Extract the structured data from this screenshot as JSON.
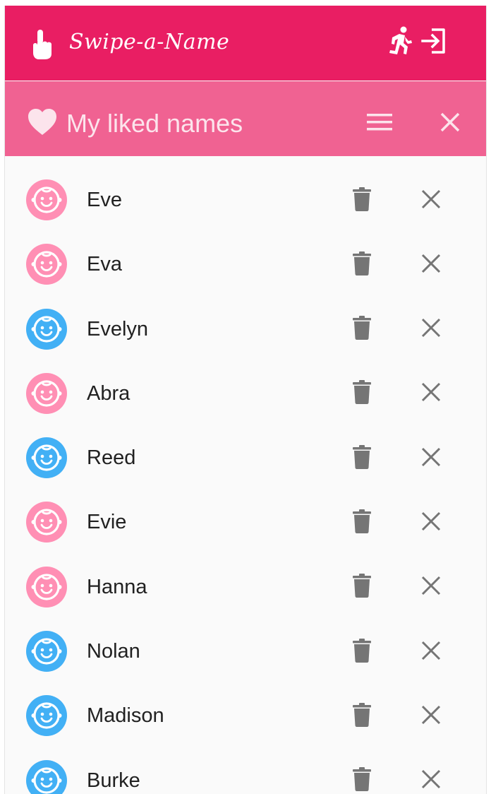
{
  "app": {
    "title": "Swipe-a-Name",
    "colors": {
      "primary": "#e91e63",
      "secondary": "#f06292",
      "girl": "#ff8fb4",
      "boy": "#42b0f5"
    },
    "icons": {
      "logo": "touch-icon",
      "run": "run-icon",
      "logout": "logout-icon"
    }
  },
  "panel": {
    "title": "My liked names",
    "icons": {
      "heart": "heart-icon",
      "menu": "menu-icon",
      "close": "close-icon"
    }
  },
  "liked_names": [
    {
      "name": "Eve",
      "gender": "girl"
    },
    {
      "name": "Eva",
      "gender": "girl"
    },
    {
      "name": "Evelyn",
      "gender": "boy"
    },
    {
      "name": "Abra",
      "gender": "girl"
    },
    {
      "name": "Reed",
      "gender": "boy"
    },
    {
      "name": "Evie",
      "gender": "girl"
    },
    {
      "name": "Hanna",
      "gender": "girl"
    },
    {
      "name": "Nolan",
      "gender": "boy"
    },
    {
      "name": "Madison",
      "gender": "boy"
    },
    {
      "name": "Burke",
      "gender": "boy"
    }
  ]
}
